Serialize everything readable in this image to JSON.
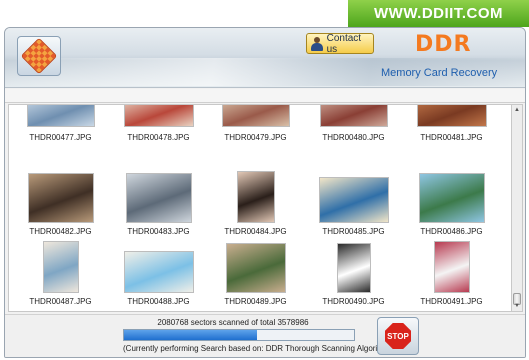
{
  "website": "WWW.DDIIT.COM",
  "header": {
    "contact_label": "Contact us",
    "brand": "DDR",
    "product": "Memory Card Recovery"
  },
  "gallery": {
    "rows": [
      [
        {
          "name": "THDR00477.JPG",
          "icon": "skaters-photo",
          "colors": [
            "#6f8fb0",
            "#c9d8e6"
          ]
        },
        {
          "name": "THDR00478.JPG",
          "icon": "group-dinner-photo",
          "colors": [
            "#b9473a",
            "#e9d3c2"
          ]
        },
        {
          "name": "THDR00479.JPG",
          "icon": "dancers-photo",
          "colors": [
            "#9a5a4a",
            "#d9c0a8"
          ]
        },
        {
          "name": "THDR00480.JPG",
          "icon": "party-photo",
          "colors": [
            "#8a3f35",
            "#cfa99a"
          ]
        },
        {
          "name": "THDR00481.JPG",
          "icon": "crowd-photo",
          "colors": [
            "#7a3a22",
            "#c2774a"
          ]
        }
      ],
      [
        {
          "name": "THDR00482.JPG",
          "icon": "couple-photo",
          "colors": [
            "#3f2f25",
            "#b89a7a"
          ]
        },
        {
          "name": "THDR00483.JPG",
          "icon": "office-photo",
          "colors": [
            "#5d6a78",
            "#cfd6dd"
          ]
        },
        {
          "name": "THDR00484.JPG",
          "icon": "portrait-photo",
          "colors": [
            "#2a1f1a",
            "#e2c8b6"
          ]
        },
        {
          "name": "THDR00485.JPG",
          "icon": "beach-photo",
          "colors": [
            "#2f6fa8",
            "#f2e6c8"
          ]
        },
        {
          "name": "THDR00486.JPG",
          "icon": "island-photo",
          "colors": [
            "#3c7a4a",
            "#8fc6e3"
          ]
        }
      ],
      [
        {
          "name": "THDR00487.JPG",
          "icon": "woman-sitting-photo",
          "colors": [
            "#7fa6c4",
            "#efe7dc"
          ]
        },
        {
          "name": "THDR00488.JPG",
          "icon": "umbrella-beach-photo",
          "colors": [
            "#7cc0e6",
            "#f0efe8"
          ]
        },
        {
          "name": "THDR00489.JPG",
          "icon": "family-photo",
          "colors": [
            "#4a6a3a",
            "#c9ae8f"
          ]
        },
        {
          "name": "THDR00490.JPG",
          "icon": "woman-laptop-photo",
          "colors": [
            "#ffffff",
            "#2a2a2a"
          ]
        },
        {
          "name": "THDR00491.JPG",
          "icon": "woman-standing-photo",
          "colors": [
            "#f4f4f4",
            "#b73a50"
          ]
        }
      ]
    ]
  },
  "status": {
    "sectors_text": "2080768 sectors scanned of total 3578986",
    "progress_fraction": 0.58,
    "scan_note": "(Currently performing Search based on:  DDR Thorough Scanning Algorithm)",
    "stop_label": "STOP"
  },
  "colors": {
    "brand_orange": "#f47a20",
    "product_blue": "#1f5fae",
    "progress_blue": "#1f6fcf",
    "stop_red": "#d9231b"
  }
}
